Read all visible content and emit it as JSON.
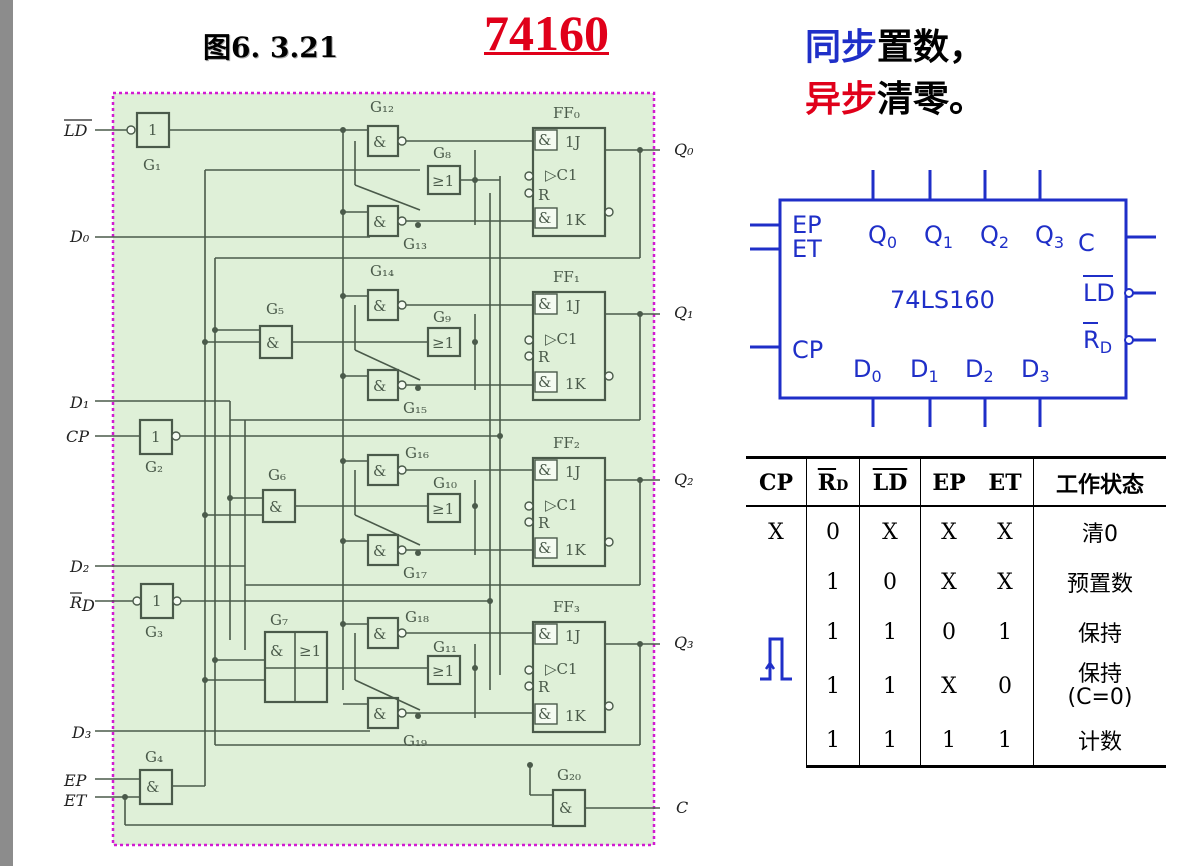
{
  "slide": {
    "figure_label": "图6. 3.21",
    "chip_title": "74160",
    "feature_line1": {
      "a": "同步",
      "b": "置数，"
    },
    "feature_line2": {
      "a": "异步",
      "b": "清零。"
    }
  },
  "circuit": {
    "input_labels": [
      "LD",
      "D₀",
      "D₁",
      "CP",
      "D₂",
      "R_D",
      "D₃",
      "EP",
      "ET"
    ],
    "output_labels": [
      "Q₀",
      "Q₁",
      "Q₂",
      "Q₃",
      "C"
    ],
    "gate_labels": [
      "G₁",
      "G₂",
      "G₃",
      "G₄",
      "G₅",
      "G₆",
      "G₇",
      "G₈",
      "G₉",
      "G₁₀",
      "G₁₁",
      "G₁₂",
      "G₁₃",
      "G₁₄",
      "G₁₅",
      "G₁₆",
      "G₁₇",
      "G₁₈",
      "G₁₉",
      "G₂₀"
    ],
    "flipflop_labels": [
      "FF₀",
      "FF₁",
      "FF₂",
      "FF₃"
    ]
  },
  "symbol": {
    "name": "74LS160",
    "pins_left": [
      "EP",
      "ET",
      "CP"
    ],
    "pins_top": [
      "Q0",
      "Q1",
      "Q2",
      "Q3"
    ],
    "pins_bottom": [
      "D0",
      "D1",
      "D2",
      "D3"
    ],
    "pins_right": [
      "C",
      "LD",
      "RD"
    ]
  },
  "truth_table": {
    "headers": [
      "CP",
      "R_D",
      "LD",
      "EP",
      "ET",
      "工作状态"
    ],
    "rows": [
      [
        "X",
        "0",
        "X",
        "X",
        "X",
        "清0"
      ],
      [
        "",
        "1",
        "0",
        "X",
        "X",
        "预置数"
      ],
      [
        "rising-edge",
        "1",
        "1",
        "0",
        "1",
        "保持"
      ],
      [
        "",
        "1",
        "1",
        "X",
        "0",
        "保持(C=0)"
      ],
      [
        "",
        "1",
        "1",
        "1",
        "1",
        "计数"
      ]
    ],
    "row4_state_line1": "保持",
    "row4_state_line2": "(C=0)"
  },
  "colors": {
    "circuit_bg": "#dff0d8",
    "circuit_border": "#d21bd2",
    "wire": "#4a5a4a",
    "symbol": "#1f2fc8",
    "red": "#e0001a"
  }
}
